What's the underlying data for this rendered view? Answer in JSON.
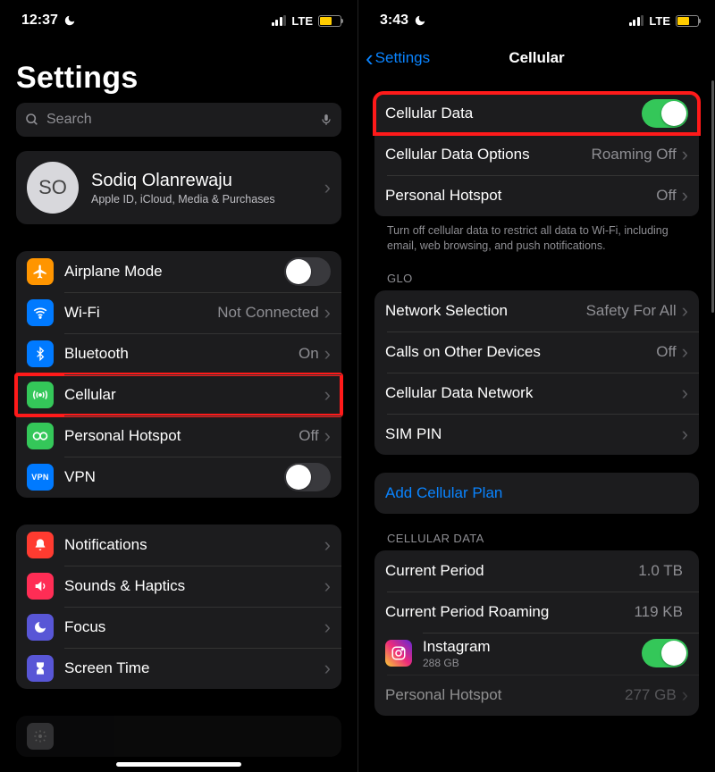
{
  "left": {
    "status_time": "12:37",
    "status_lte": "LTE",
    "title": "Settings",
    "search_placeholder": "Search",
    "profile": {
      "initials": "SO",
      "name": "Sodiq Olanrewaju",
      "subtitle": "Apple ID, iCloud, Media & Purchases"
    },
    "airplane": "Airplane Mode",
    "wifi": "Wi-Fi",
    "wifi_value": "Not Connected",
    "bluetooth": "Bluetooth",
    "bluetooth_value": "On",
    "cellular": "Cellular",
    "hotspot": "Personal Hotspot",
    "hotspot_value": "Off",
    "vpn": "VPN",
    "notifications": "Notifications",
    "sounds": "Sounds & Haptics",
    "focus": "Focus",
    "screentime": "Screen Time"
  },
  "right": {
    "status_time": "3:43",
    "status_lte": "LTE",
    "back_label": "Settings",
    "nav_title": "Cellular",
    "cellular_data": "Cellular Data",
    "options": "Cellular Data Options",
    "options_value": "Roaming Off",
    "hotspot": "Personal Hotspot",
    "hotspot_value": "Off",
    "footer1": "Turn off cellular data to restrict all data to Wi-Fi, including email, web browsing, and push notifications.",
    "carrier_header": "GLO",
    "network_sel": "Network Selection",
    "network_sel_value": "Safety For All",
    "calls_other": "Calls on Other Devices",
    "calls_other_value": "Off",
    "cdn": "Cellular Data Network",
    "sim_pin": "SIM PIN",
    "add_plan": "Add Cellular Plan",
    "usage_header": "CELLULAR DATA",
    "current_period": "Current Period",
    "current_period_value": "1.0 TB",
    "roaming_period": "Current Period Roaming",
    "roaming_period_value": "119 KB",
    "app1": "Instagram",
    "app1_sub": "288 GB",
    "app2": "Personal Hotspot",
    "app2_value": "277 GB"
  }
}
